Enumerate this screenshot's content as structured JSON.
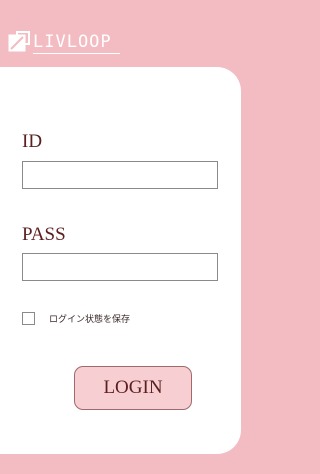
{
  "brand": {
    "logo_text": "LIVLOOP",
    "logo_icon": "square-corner-icon"
  },
  "form": {
    "id_label": "ID",
    "id_value": "",
    "pass_label": "PASS",
    "pass_value": "",
    "remember_label": "ログイン状態を保存",
    "remember_checked": false,
    "login_button_label": "LOGIN"
  },
  "colors": {
    "background": "#f2bcc2",
    "panel": "#ffffff",
    "label_text": "#5a1f1f",
    "button_fill": "#f7cfd3"
  }
}
